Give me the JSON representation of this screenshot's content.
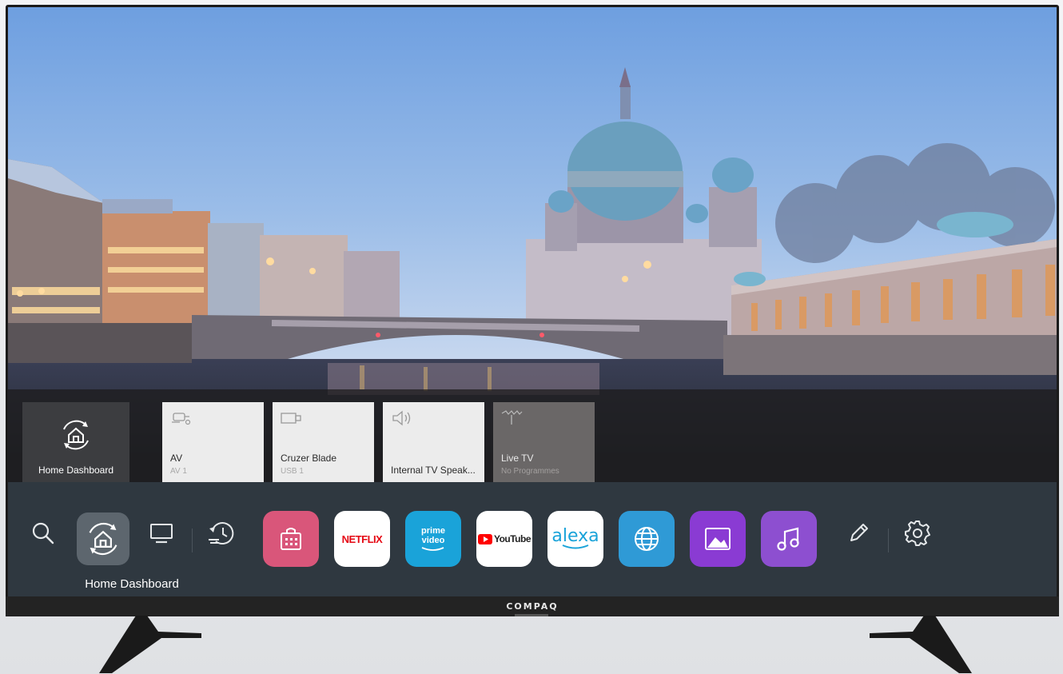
{
  "brand": "COMPAQ",
  "recent_inputs": [
    {
      "name": "Home Dashboard",
      "sub": "",
      "icon": "home-dashboard-icon",
      "style": "home"
    },
    {
      "name": "AV",
      "sub": "AV 1",
      "icon": "av-input-icon",
      "style": "light"
    },
    {
      "name": "Cruzer Blade",
      "sub": "USB 1",
      "icon": "usb-drive-icon",
      "style": "light"
    },
    {
      "name": "Internal TV Speak...",
      "sub": "",
      "icon": "speaker-icon",
      "style": "light"
    },
    {
      "name": "Live TV",
      "sub": "No Programmes",
      "icon": "antenna-icon",
      "style": "dark"
    }
  ],
  "launcher": {
    "focused_label": "Home Dashboard",
    "system_icons": [
      "search-icon",
      "home-dashboard-icon",
      "tv-icon",
      "recent-history-icon"
    ],
    "apps": [
      {
        "name": "store",
        "label": "",
        "icon": "store-bag-icon",
        "color": "#d9567a"
      },
      {
        "name": "netflix",
        "label": "NETFLIX",
        "icon": "netflix-logo",
        "color": "#ffffff"
      },
      {
        "name": "prime-video",
        "label": "prime video",
        "icon": "prime-video-logo",
        "color": "#1aa3d9"
      },
      {
        "name": "youtube",
        "label": "YouTube",
        "icon": "youtube-logo",
        "color": "#ffffff"
      },
      {
        "name": "alexa",
        "label": "alexa",
        "icon": "alexa-logo",
        "color": "#ffffff"
      },
      {
        "name": "web-browser",
        "label": "",
        "icon": "globe-icon",
        "color": "#2f9ad6"
      },
      {
        "name": "gallery",
        "label": "",
        "icon": "photo-icon",
        "color": "#8a3bd3"
      },
      {
        "name": "music",
        "label": "",
        "icon": "music-note-icon",
        "color": "#8d4fd0"
      }
    ],
    "end_icons": [
      "edit-pencil-icon",
      "settings-gear-icon"
    ]
  },
  "colors": {
    "launcher_bg": "#2f3840",
    "card_light": "#ececec",
    "card_dark": "#6a6767",
    "netflix_red": "#e50914",
    "youtube_red": "#ff0000",
    "alexa_blue": "#1aa3d9"
  }
}
